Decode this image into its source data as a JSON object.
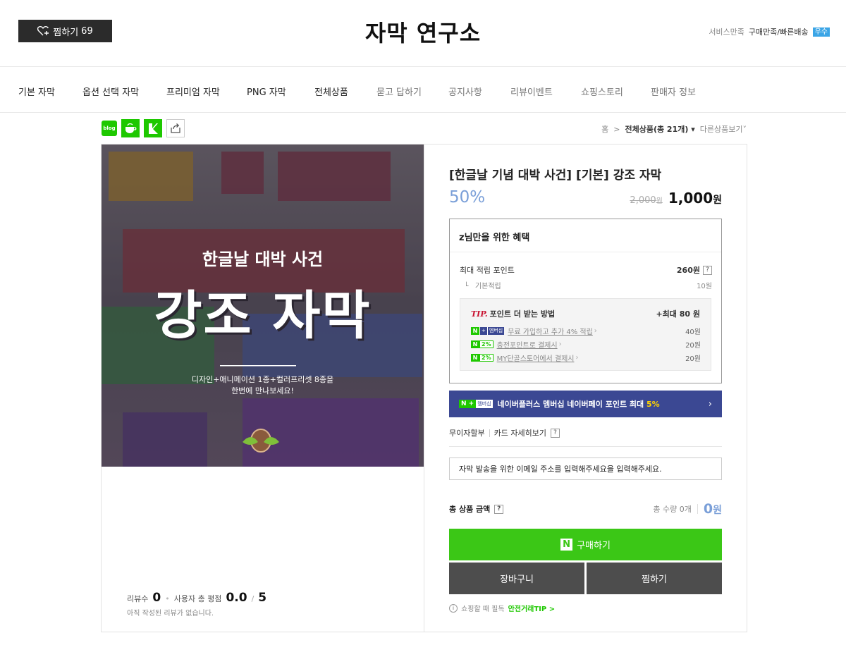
{
  "header": {
    "wishlist_label": "찜하기",
    "wishlist_count": "69",
    "store_name": "자막 연구소",
    "service_label": "서비스만족",
    "delivery_label": "구매만족/빠른배송",
    "grade": "우수"
  },
  "nav": {
    "items": [
      {
        "label": "기본 자막"
      },
      {
        "label": "옵션 선택 자막"
      },
      {
        "label": "프리미엄 자막"
      },
      {
        "label": "PNG 자막"
      },
      {
        "label": "전체상품"
      },
      {
        "label": "묻고 답하기"
      },
      {
        "label": "공지사항"
      },
      {
        "label": "리뷰이벤트"
      },
      {
        "label": "쇼핑스토리"
      },
      {
        "label": "판매자 정보"
      }
    ]
  },
  "share": {
    "blog_label": "blog"
  },
  "breadcrumb": {
    "home": "홈",
    "sep": ">",
    "current": "전체상품(총 21개)",
    "other": "다른상품보기"
  },
  "gallery": {
    "top_caption": "한글날 대박 사건",
    "main_title": "강조 자막",
    "desc_line1": "디자인+애니메이션 1종+컬러프리셋 8종을",
    "desc_line2": "한번에 만나보세요!"
  },
  "reviews": {
    "count_label": "리뷰수",
    "count": "0",
    "rating_label": "사용자 총 평점",
    "rating": "0.0",
    "rating_max": "5",
    "empty_text": "아직 작성된 리뷰가 없습니다."
  },
  "product": {
    "title": "[한글날 기념 대박 사건] [기본] 강조 자막",
    "discount": "50%",
    "original_price": "2,000",
    "original_unit": "원",
    "price": "1,000",
    "price_unit": "원"
  },
  "benefit": {
    "header": "z님만을 위한 혜택",
    "max_points_label": "최대 적립 포인트",
    "max_points": "260원",
    "basic_label": "기본적립",
    "basic_value": "10원",
    "tip_label": "TIP.",
    "tip_title": "포인트 더 받는 방법",
    "tip_max": "+최대 80 원",
    "tips": [
      {
        "tag": "멤버십",
        "text": "무료 가입하고 추가 4% 적립",
        "amount": "40원"
      },
      {
        "tag": "2%",
        "text": "충전포인트로 결제시",
        "amount": "20원"
      },
      {
        "tag": "2%",
        "text": "MY단골스토어에서 결제시",
        "amount": "20원"
      }
    ]
  },
  "membership": {
    "tag_n": "N +",
    "tag_r": "멤버십",
    "text": "네이버플러스 멤버십 네이버페이 포인트 최대",
    "highlight": "5%",
    "arrow": "›"
  },
  "installment": {
    "label": "무이자할부",
    "card_label": "카드 자세히보기"
  },
  "email": {
    "placeholder": "자막 발송을 위한 이메일 주소를 입력해주세요을 입력해주세요."
  },
  "total": {
    "label": "총 상품 금액",
    "qty": "총 수량 0개",
    "amount": "0",
    "unit": "원"
  },
  "buttons": {
    "buy_icon": "N",
    "buy": "구매하기",
    "cart": "장바구니",
    "wish": "찜하기"
  },
  "safe": {
    "text": "쇼핑할 때 필독",
    "link": "안전거래TIP >"
  },
  "colors": {
    "naver_green": "#1ec800",
    "buy_green": "#3bc716",
    "discount_blue": "#7a9fd8",
    "membership_navy": "#3b4893",
    "dark_button": "#4d4d4d"
  }
}
